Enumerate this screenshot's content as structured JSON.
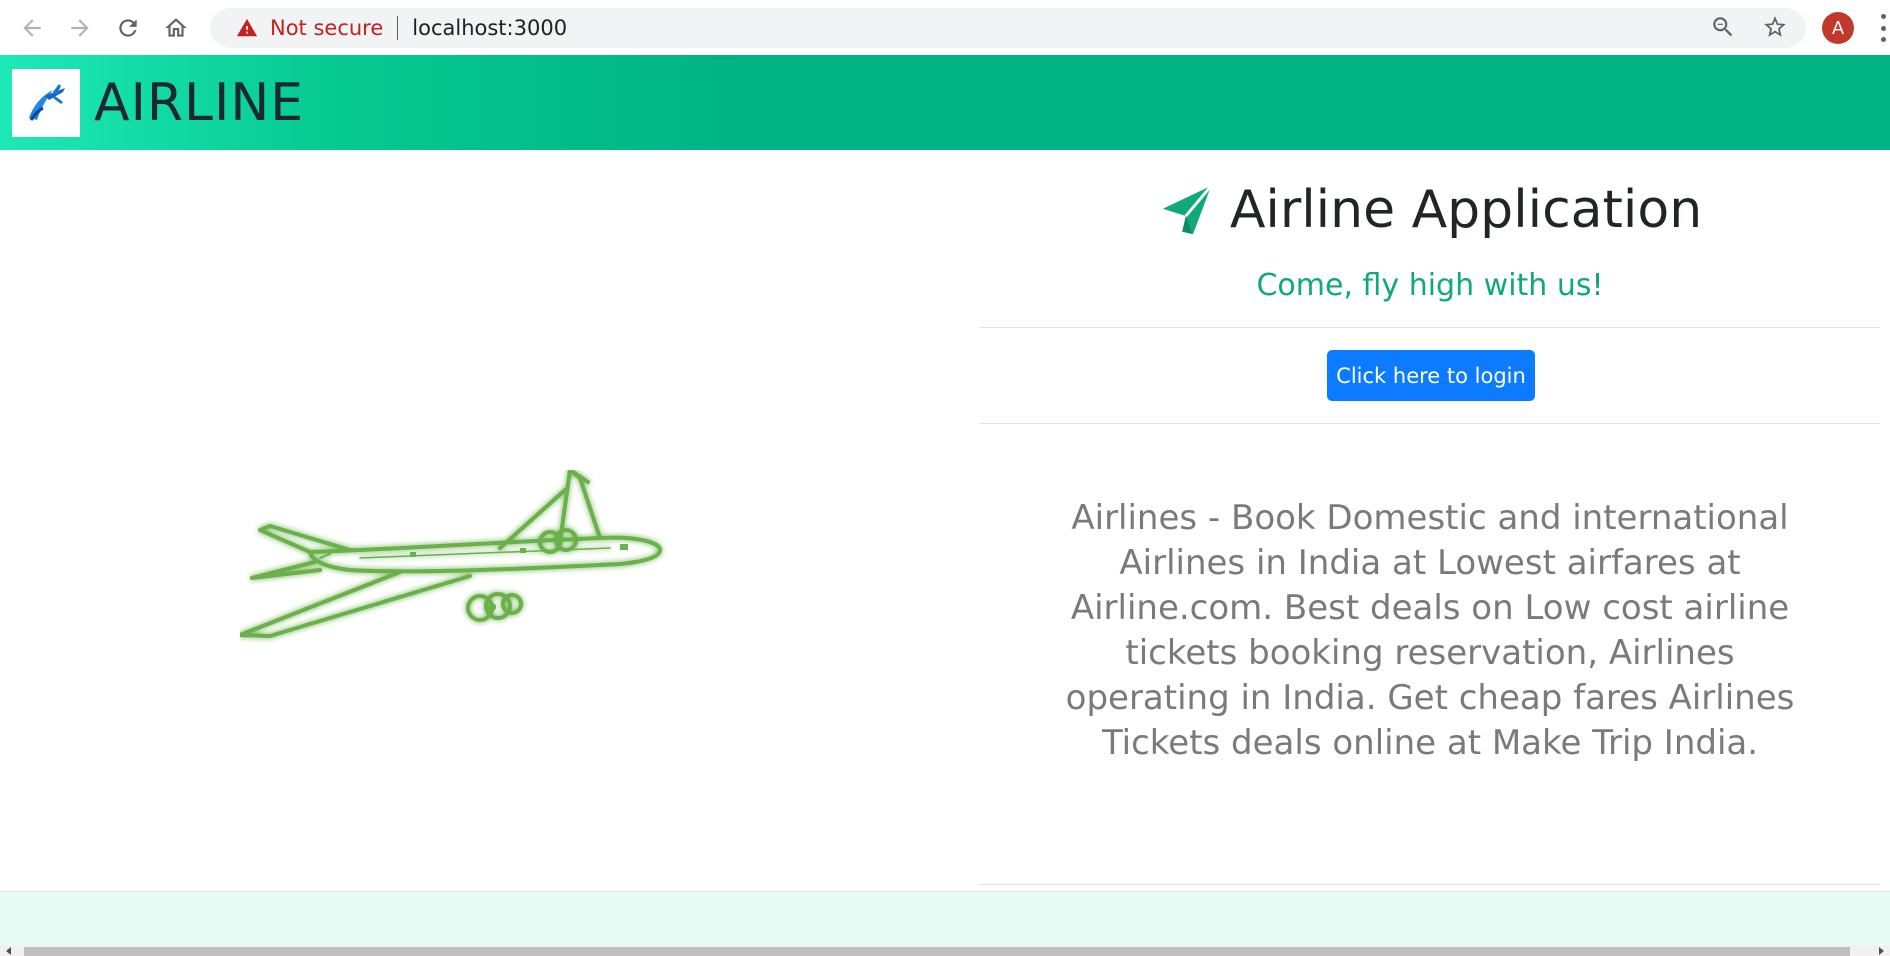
{
  "browser": {
    "security_label": "Not secure",
    "url": "localhost:3000",
    "profile_initial": "A",
    "icons": [
      "back-icon",
      "forward-icon",
      "reload-icon",
      "home-icon",
      "warning-icon",
      "zoom-out-icon",
      "star-icon",
      "menu-icon"
    ]
  },
  "header": {
    "brand": "AIRLINE",
    "logo_icon": "airplane-logo-icon",
    "background_color": "#00b383",
    "gradient_start": "#1de9b6"
  },
  "main": {
    "title": "Airline Application",
    "title_icon": "paper-plane-icon",
    "tagline": "Come, fly high with us!",
    "login_button": "Click here to login",
    "description": "Airlines - Book Domestic and international Airlines in India at Lowest airfares at Airline.com. Best deals on Low cost airline tickets booking reservation, Airlines operating in India. Get cheap fares Airlines Tickets deals online at Make Trip India.",
    "hero_icon": "airplane-illustration"
  },
  "colors": {
    "accent": "#10a97a",
    "button": "#0d7bff",
    "footer": "#e6fcf5",
    "text_muted": "#7a7a7a"
  }
}
